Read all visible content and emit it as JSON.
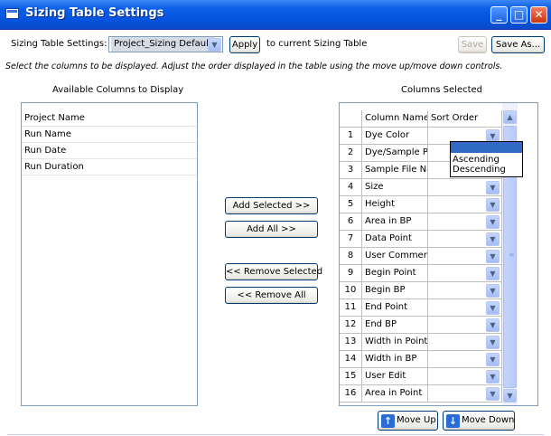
{
  "window": {
    "title": "Sizing Table Settings",
    "buttons": {
      "minimize": "_",
      "maximize": "□",
      "close": "✕"
    }
  },
  "toolbar": {
    "settings_label": "Sizing Table Settings:",
    "settings_value": "Project_Sizing Default",
    "apply_label": "Apply",
    "apply_suffix": "to current Sizing Table",
    "save_label": "Save",
    "save_as_label": "Save As..."
  },
  "instructions": "Select the columns to be displayed.  Adjust the order displayed in the table using the move up/move down controls.",
  "available": {
    "title": "Available Columns to Display",
    "items": [
      "Project Name",
      "Run Name",
      "Run Date",
      "Run Duration"
    ]
  },
  "middle_buttons": {
    "add_selected": "Add Selected >>",
    "add_all": "Add All >>",
    "remove_selected": "<< Remove Selected",
    "remove_all": "<< Remove All"
  },
  "selected": {
    "title": "Columns Selected",
    "headers": {
      "name": "Column Name",
      "sort": "Sort Order"
    },
    "rows": [
      {
        "num": "1",
        "name": "Dye Color"
      },
      {
        "num": "2",
        "name": "Dye/Sample Peak"
      },
      {
        "num": "3",
        "name": "Sample File Name"
      },
      {
        "num": "4",
        "name": "Size"
      },
      {
        "num": "5",
        "name": "Height"
      },
      {
        "num": "6",
        "name": "Area in BP"
      },
      {
        "num": "7",
        "name": "Data Point"
      },
      {
        "num": "8",
        "name": "User Comments"
      },
      {
        "num": "9",
        "name": "Begin Point"
      },
      {
        "num": "10",
        "name": "Begin BP"
      },
      {
        "num": "11",
        "name": "End Point"
      },
      {
        "num": "12",
        "name": "End BP"
      },
      {
        "num": "13",
        "name": "Width in Point"
      },
      {
        "num": "14",
        "name": "Width in BP"
      },
      {
        "num": "15",
        "name": "User Edit"
      },
      {
        "num": "16",
        "name": "Area in Point"
      }
    ],
    "sort_options": [
      "",
      "Ascending",
      "Descending"
    ]
  },
  "move_buttons": {
    "up": "Move Up",
    "down": "Move Down"
  },
  "colors": {
    "titlebar": "#0553df",
    "popup_highlight": "#316ac5"
  },
  "icons": {
    "up": "arrow-up-icon",
    "down": "arrow-down-icon",
    "dropdown": "chevron-down-icon"
  }
}
